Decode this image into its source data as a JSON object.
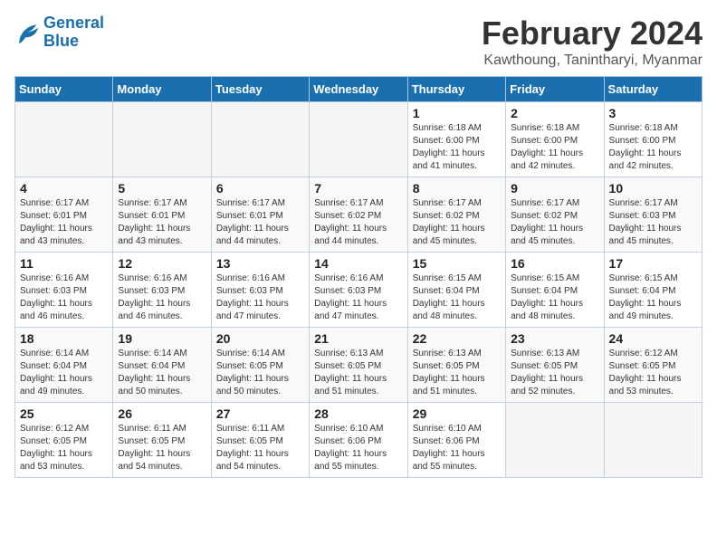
{
  "logo": {
    "line1": "General",
    "line2": "Blue"
  },
  "title": "February 2024",
  "subtitle": "Kawthoung, Tanintharyi, Myanmar",
  "headers": [
    "Sunday",
    "Monday",
    "Tuesday",
    "Wednesday",
    "Thursday",
    "Friday",
    "Saturday"
  ],
  "weeks": [
    [
      {
        "day": "",
        "info": ""
      },
      {
        "day": "",
        "info": ""
      },
      {
        "day": "",
        "info": ""
      },
      {
        "day": "",
        "info": ""
      },
      {
        "day": "1",
        "info": "Sunrise: 6:18 AM\nSunset: 6:00 PM\nDaylight: 11 hours\nand 41 minutes."
      },
      {
        "day": "2",
        "info": "Sunrise: 6:18 AM\nSunset: 6:00 PM\nDaylight: 11 hours\nand 42 minutes."
      },
      {
        "day": "3",
        "info": "Sunrise: 6:18 AM\nSunset: 6:00 PM\nDaylight: 11 hours\nand 42 minutes."
      }
    ],
    [
      {
        "day": "4",
        "info": "Sunrise: 6:17 AM\nSunset: 6:01 PM\nDaylight: 11 hours\nand 43 minutes."
      },
      {
        "day": "5",
        "info": "Sunrise: 6:17 AM\nSunset: 6:01 PM\nDaylight: 11 hours\nand 43 minutes."
      },
      {
        "day": "6",
        "info": "Sunrise: 6:17 AM\nSunset: 6:01 PM\nDaylight: 11 hours\nand 44 minutes."
      },
      {
        "day": "7",
        "info": "Sunrise: 6:17 AM\nSunset: 6:02 PM\nDaylight: 11 hours\nand 44 minutes."
      },
      {
        "day": "8",
        "info": "Sunrise: 6:17 AM\nSunset: 6:02 PM\nDaylight: 11 hours\nand 45 minutes."
      },
      {
        "day": "9",
        "info": "Sunrise: 6:17 AM\nSunset: 6:02 PM\nDaylight: 11 hours\nand 45 minutes."
      },
      {
        "day": "10",
        "info": "Sunrise: 6:17 AM\nSunset: 6:03 PM\nDaylight: 11 hours\nand 45 minutes."
      }
    ],
    [
      {
        "day": "11",
        "info": "Sunrise: 6:16 AM\nSunset: 6:03 PM\nDaylight: 11 hours\nand 46 minutes."
      },
      {
        "day": "12",
        "info": "Sunrise: 6:16 AM\nSunset: 6:03 PM\nDaylight: 11 hours\nand 46 minutes."
      },
      {
        "day": "13",
        "info": "Sunrise: 6:16 AM\nSunset: 6:03 PM\nDaylight: 11 hours\nand 47 minutes."
      },
      {
        "day": "14",
        "info": "Sunrise: 6:16 AM\nSunset: 6:03 PM\nDaylight: 11 hours\nand 47 minutes."
      },
      {
        "day": "15",
        "info": "Sunrise: 6:15 AM\nSunset: 6:04 PM\nDaylight: 11 hours\nand 48 minutes."
      },
      {
        "day": "16",
        "info": "Sunrise: 6:15 AM\nSunset: 6:04 PM\nDaylight: 11 hours\nand 48 minutes."
      },
      {
        "day": "17",
        "info": "Sunrise: 6:15 AM\nSunset: 6:04 PM\nDaylight: 11 hours\nand 49 minutes."
      }
    ],
    [
      {
        "day": "18",
        "info": "Sunrise: 6:14 AM\nSunset: 6:04 PM\nDaylight: 11 hours\nand 49 minutes."
      },
      {
        "day": "19",
        "info": "Sunrise: 6:14 AM\nSunset: 6:04 PM\nDaylight: 11 hours\nand 50 minutes."
      },
      {
        "day": "20",
        "info": "Sunrise: 6:14 AM\nSunset: 6:05 PM\nDaylight: 11 hours\nand 50 minutes."
      },
      {
        "day": "21",
        "info": "Sunrise: 6:13 AM\nSunset: 6:05 PM\nDaylight: 11 hours\nand 51 minutes."
      },
      {
        "day": "22",
        "info": "Sunrise: 6:13 AM\nSunset: 6:05 PM\nDaylight: 11 hours\nand 51 minutes."
      },
      {
        "day": "23",
        "info": "Sunrise: 6:13 AM\nSunset: 6:05 PM\nDaylight: 11 hours\nand 52 minutes."
      },
      {
        "day": "24",
        "info": "Sunrise: 6:12 AM\nSunset: 6:05 PM\nDaylight: 11 hours\nand 53 minutes."
      }
    ],
    [
      {
        "day": "25",
        "info": "Sunrise: 6:12 AM\nSunset: 6:05 PM\nDaylight: 11 hours\nand 53 minutes."
      },
      {
        "day": "26",
        "info": "Sunrise: 6:11 AM\nSunset: 6:05 PM\nDaylight: 11 hours\nand 54 minutes."
      },
      {
        "day": "27",
        "info": "Sunrise: 6:11 AM\nSunset: 6:05 PM\nDaylight: 11 hours\nand 54 minutes."
      },
      {
        "day": "28",
        "info": "Sunrise: 6:10 AM\nSunset: 6:06 PM\nDaylight: 11 hours\nand 55 minutes."
      },
      {
        "day": "29",
        "info": "Sunrise: 6:10 AM\nSunset: 6:06 PM\nDaylight: 11 hours\nand 55 minutes."
      },
      {
        "day": "",
        "info": ""
      },
      {
        "day": "",
        "info": ""
      }
    ]
  ]
}
